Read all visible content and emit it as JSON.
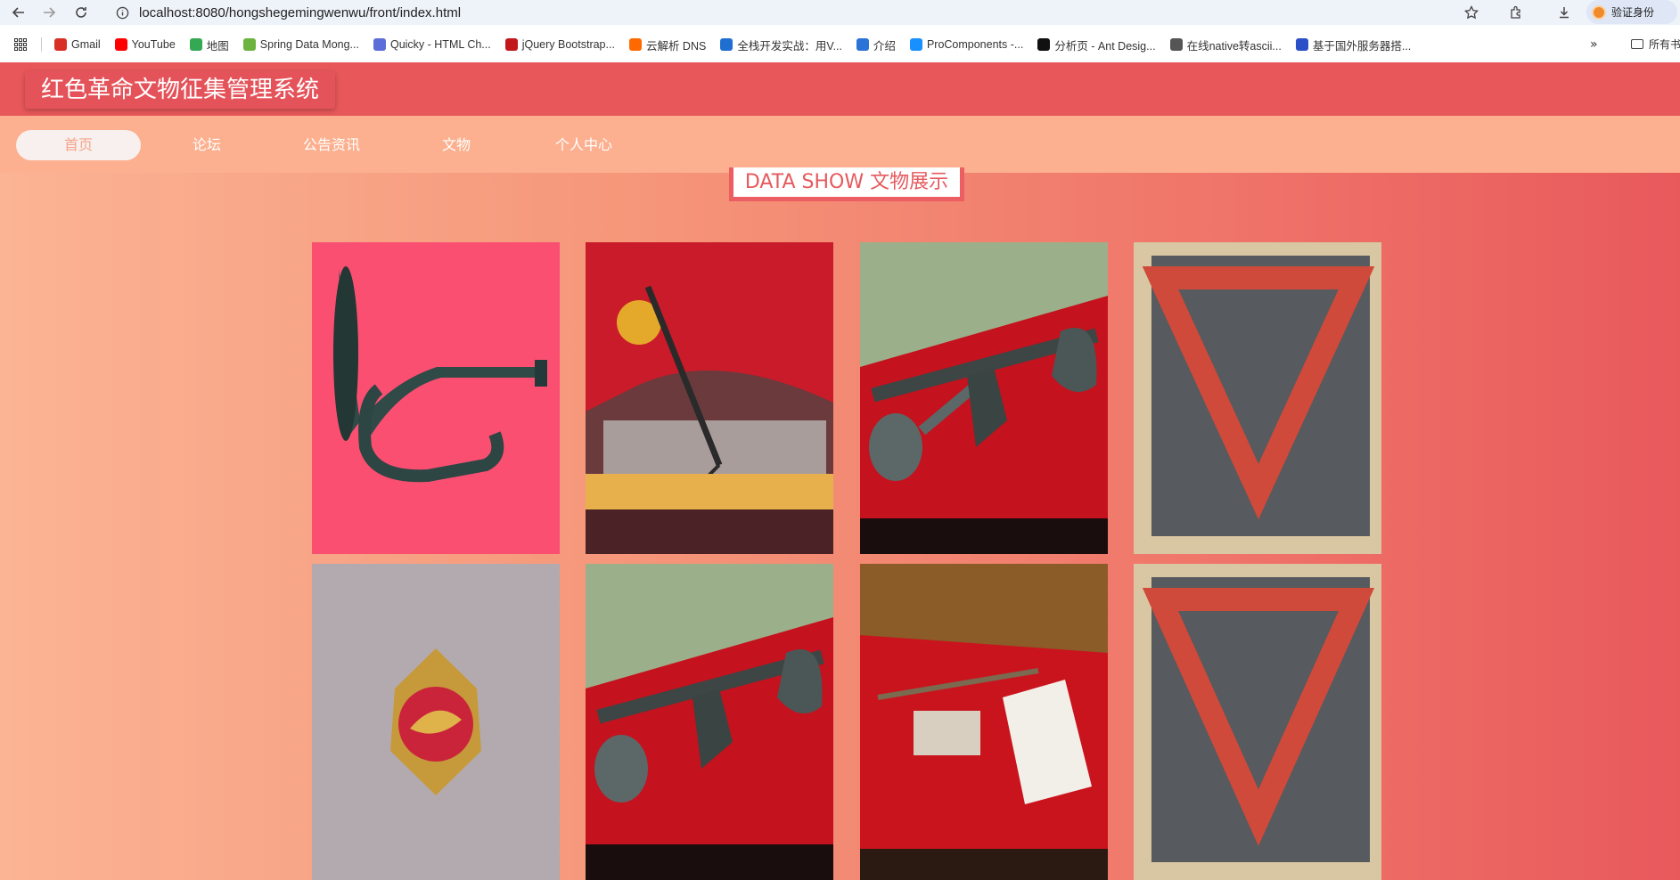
{
  "browser": {
    "url": "localhost:8080/hongshegemingwenwu/front/index.html",
    "profile_label": "验证身份",
    "bookmarks": [
      {
        "label": "Gmail",
        "color": "#d93025"
      },
      {
        "label": "YouTube",
        "color": "#ff0000"
      },
      {
        "label": "地图",
        "color": "#34a853"
      },
      {
        "label": "Spring Data Mong...",
        "color": "#6db33f"
      },
      {
        "label": "Quicky - HTML Ch...",
        "color": "#5b6dd8"
      },
      {
        "label": "jQuery Bootstrap...",
        "color": "#c2181c"
      },
      {
        "label": "云解析 DNS",
        "color": "#ff6a00"
      },
      {
        "label": "全栈开发实战：用V...",
        "color": "#1f6fd1"
      },
      {
        "label": "介绍",
        "color": "#2b73d6"
      },
      {
        "label": "ProComponents -...",
        "color": "#1890ff"
      },
      {
        "label": "分析页 - Ant Desig...",
        "color": "#111111"
      },
      {
        "label": "在线native转ascii...",
        "color": "#555555"
      },
      {
        "label": "基于国外服务器搭...",
        "color": "#2a4fc7"
      }
    ],
    "bookmarks_folder": "所有书"
  },
  "site": {
    "title": "红色革命文物征集管理系统",
    "nav": [
      {
        "label": "首页",
        "active": true
      },
      {
        "label": "论坛",
        "active": false
      },
      {
        "label": "公告资讯",
        "active": false
      },
      {
        "label": "文物",
        "active": false
      },
      {
        "label": "个人中心",
        "active": false
      }
    ],
    "section_title": "DATA SHOW 文物展示"
  },
  "gallery": [
    {
      "name": "bugle-artifact-image",
      "subject": "bugle"
    },
    {
      "name": "exhibit-case-gun-image",
      "subject": "exhibit-case"
    },
    {
      "name": "display-tools-image",
      "subject": "tools"
    },
    {
      "name": "red-armband-image",
      "subject": "armband"
    },
    {
      "name": "medal-badge-image",
      "subject": "badge"
    },
    {
      "name": "display-tools-image-2",
      "subject": "tools"
    },
    {
      "name": "sword-book-display-image",
      "subject": "sword-book"
    },
    {
      "name": "red-armband-image-2",
      "subject": "armband"
    }
  ]
}
